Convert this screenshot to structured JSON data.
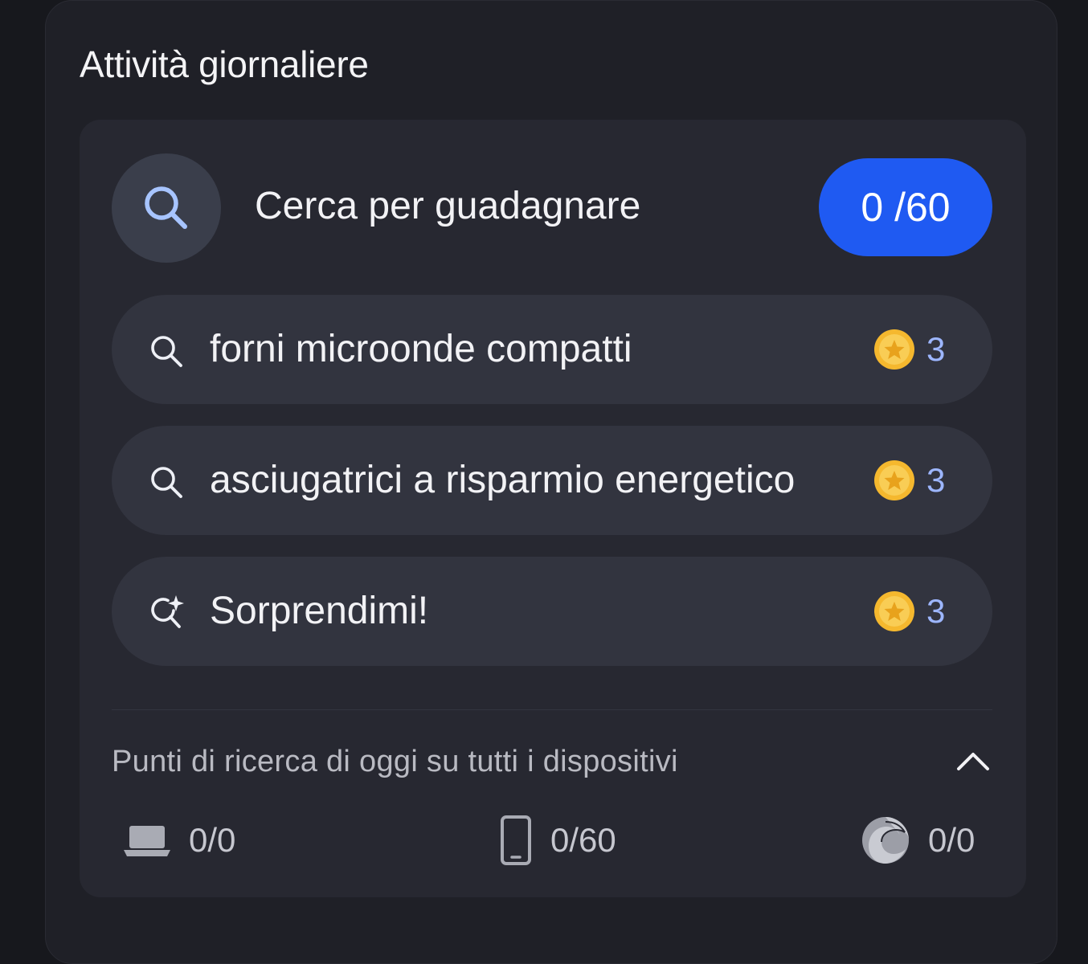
{
  "panel": {
    "title": "Attività giornaliere"
  },
  "search_task": {
    "label": "Cerca per guadagnare",
    "progress": "0 /60"
  },
  "tasks": [
    {
      "icon": "search-icon",
      "label": "forni microonde compatti",
      "points": "3"
    },
    {
      "icon": "search-icon",
      "label": "asciugatrici a risparmio energetico",
      "points": "3"
    },
    {
      "icon": "sparkle-search-icon",
      "label": "Sorprendimi!",
      "points": "3"
    }
  ],
  "footer": {
    "label": "Punti di ricerca di oggi su tutti i dispositivi",
    "devices": [
      {
        "icon": "laptop-icon",
        "value": "0/0"
      },
      {
        "icon": "phone-icon",
        "value": "0/60"
      },
      {
        "icon": "edge-icon",
        "value": "0/0"
      }
    ]
  },
  "colors": {
    "accent": "#1f5af2",
    "points_text": "#9db6ff",
    "coin": "#f5b82e"
  }
}
